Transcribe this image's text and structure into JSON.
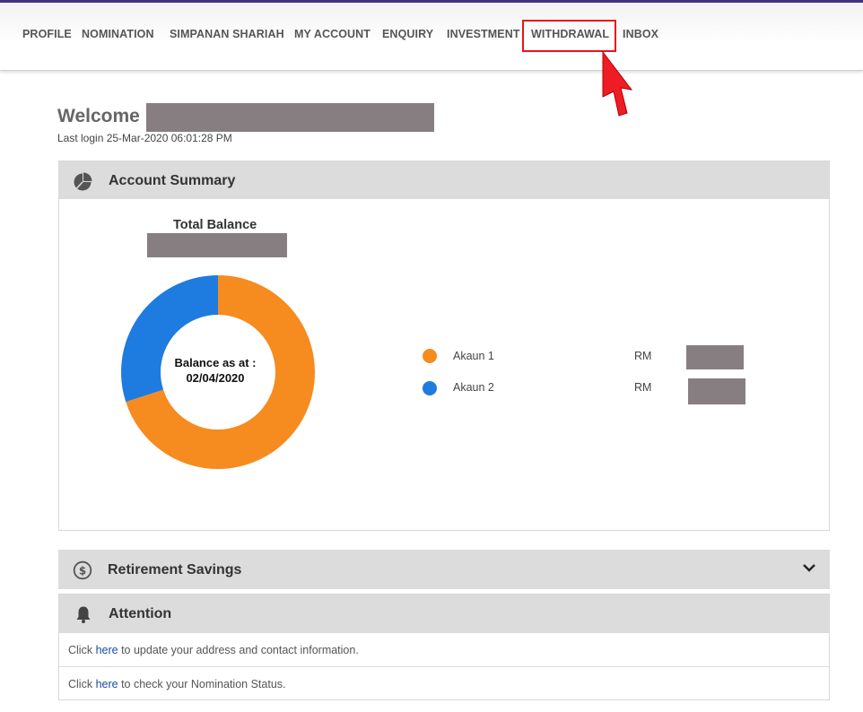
{
  "nav": {
    "items": [
      "PROFILE",
      "NOMINATION",
      "SIMPANAN SHARIAH",
      "MY ACCOUNT",
      "ENQUIRY",
      "INVESTMENT",
      "WITHDRAWAL",
      "INBOX"
    ],
    "highlighted": "WITHDRAWAL",
    "highlight_color": "#e8141b"
  },
  "welcome": {
    "greeting": "Welcome",
    "last_login": "Last login 25-Mar-2020 06:01:28 PM"
  },
  "account_summary": {
    "title": "Account Summary",
    "icon": "pie-chart-icon",
    "total_balance_label": "Total Balance",
    "center_line1": "Balance as at :",
    "center_line2": "02/04/2020",
    "currency": "RM",
    "accounts": [
      {
        "name": "Akaun 1",
        "color": "#f68b1f",
        "share": 0.7
      },
      {
        "name": "Akaun 2",
        "color": "#1e7be0",
        "share": 0.3
      }
    ]
  },
  "retirement": {
    "title": "Retirement Savings",
    "icon": "dollar-circle-icon"
  },
  "attention": {
    "title": "Attention",
    "icon": "bell-icon",
    "rows": [
      {
        "pre": "Click ",
        "link": "here",
        "post": " to update your address and contact information."
      },
      {
        "pre": "Click ",
        "link": "here",
        "post": " to check your Nomination Status."
      }
    ]
  }
}
